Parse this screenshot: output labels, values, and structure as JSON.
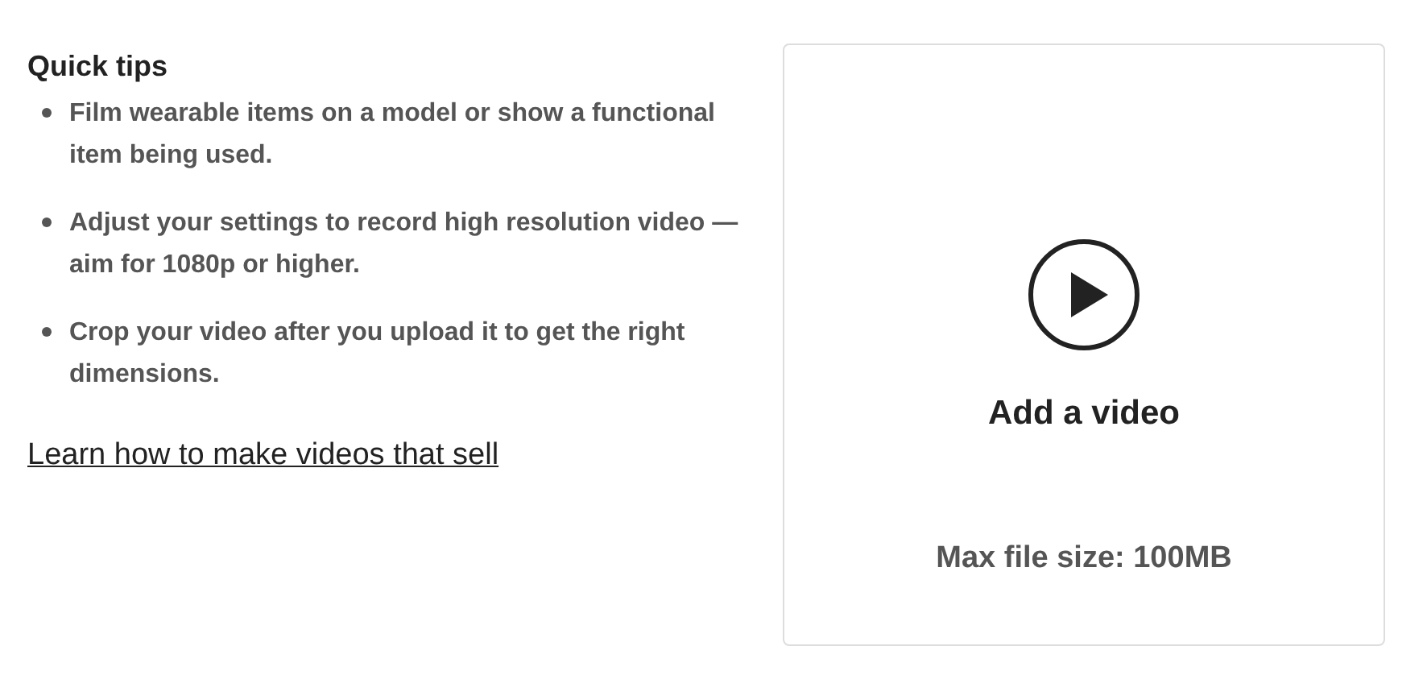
{
  "tips": {
    "title": "Quick tips",
    "items": [
      "Film wearable items on a model or show a functional item being used.",
      "Adjust your settings to record high resolution video —aim for 1080p or higher.",
      "Crop your video after you upload it to get the right dimensions."
    ],
    "link": "Learn how to make videos that sell"
  },
  "upload": {
    "label": "Add a video",
    "limit": "Max file size: 100MB"
  }
}
